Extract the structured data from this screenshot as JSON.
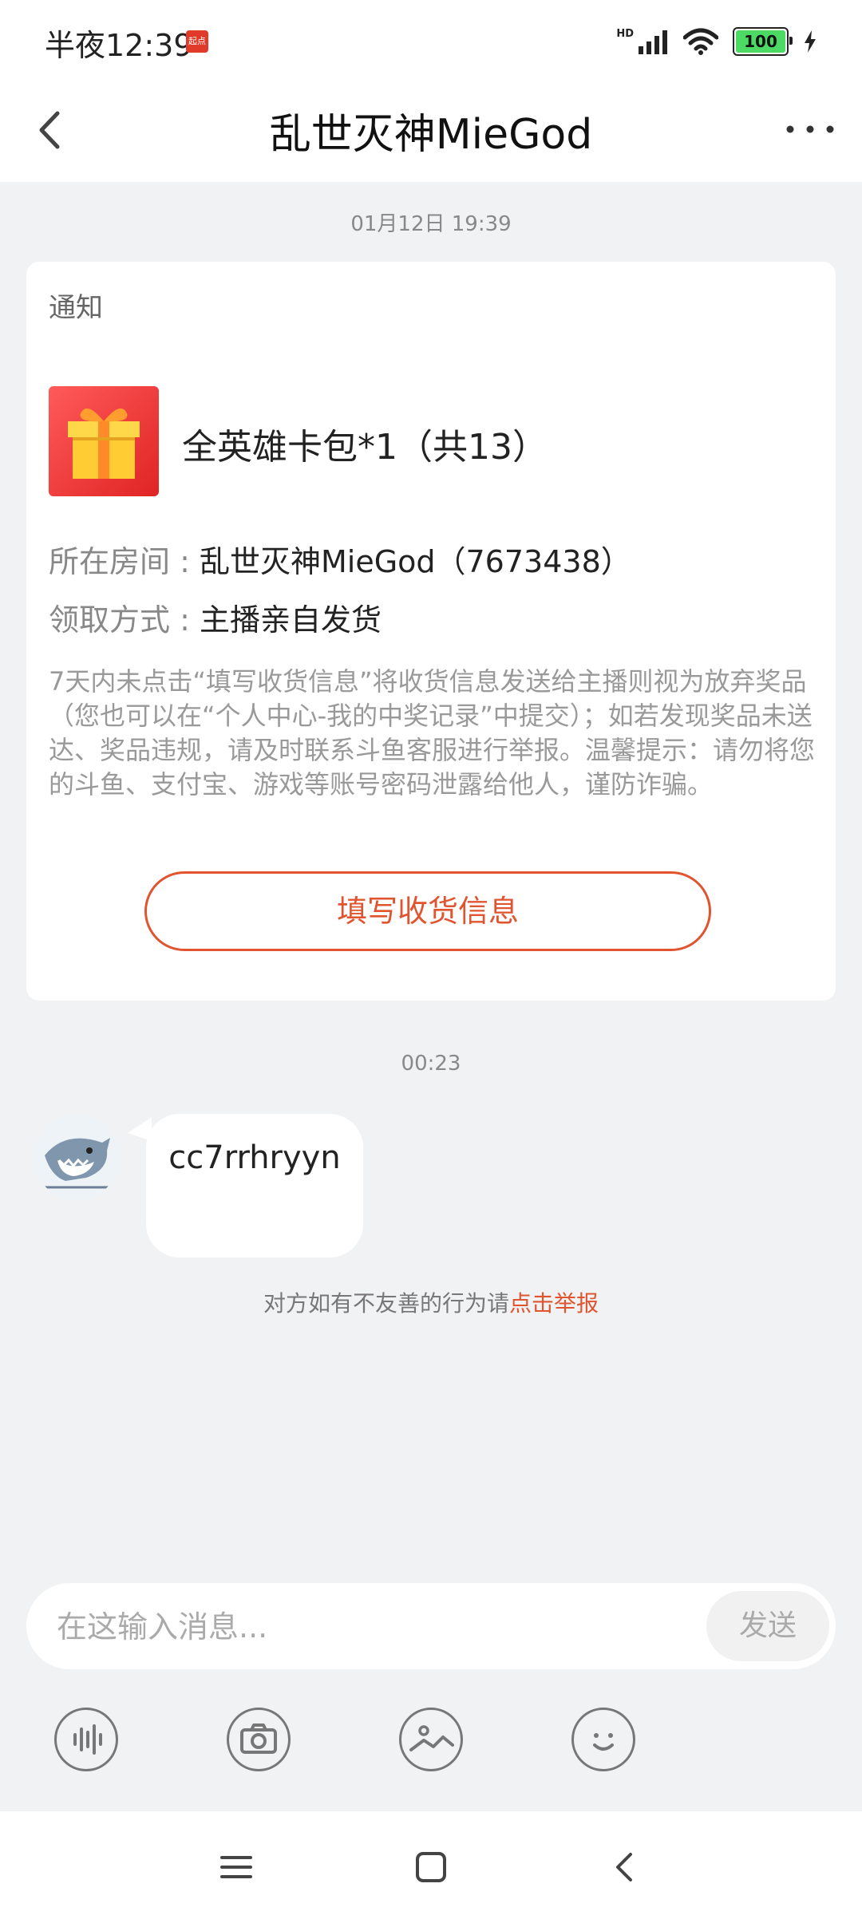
{
  "status_bar": {
    "time": "半夜12:39",
    "app_icon_text": "起点",
    "network_label": "HD",
    "battery": "100",
    "icons": [
      "signal-icon",
      "wifi-icon",
      "battery-icon",
      "charging-icon"
    ]
  },
  "header": {
    "title": "乱世灭神MieGod",
    "back_icon": "chevron-left-icon",
    "more_icon": "more-dots-icon"
  },
  "notice": {
    "timestamp": "01月12日 19:39",
    "card_title": "通知",
    "prize_name": "全英雄卡包*1（共13）",
    "room_label": "所在房间 : ",
    "room_value": "乱世灭神MieGod（7673438）",
    "method_label": "领取方式 : ",
    "method_value": "主播亲自发货",
    "notice_text": "7天内未点击“填写收货信息”将收货信息发送给主播则视为放弃奖品（您也可以在“个人中心-我的中奖记录”中提交）；如若发现奖品未送达、奖品违规，请及时联系斗鱼客服进行举报。温馨提示：请勿将您的斗鱼、支付宝、游戏等账号密码泄露给他人，谨防诈骗。",
    "fill_button": "填写收货信息"
  },
  "chat": {
    "timestamp": "00:23",
    "message": "cc7rrhryyn",
    "report_prefix": "对方如有不友善的行为请",
    "report_link": "点击举报"
  },
  "composer": {
    "placeholder": "在这输入消息...",
    "send_label": "发送"
  },
  "toolbar": {
    "items": [
      "voice-icon",
      "camera-icon",
      "image-icon",
      "emoji-icon"
    ]
  },
  "colors": {
    "accent": "#e0552f",
    "background": "#f0f2f4"
  }
}
